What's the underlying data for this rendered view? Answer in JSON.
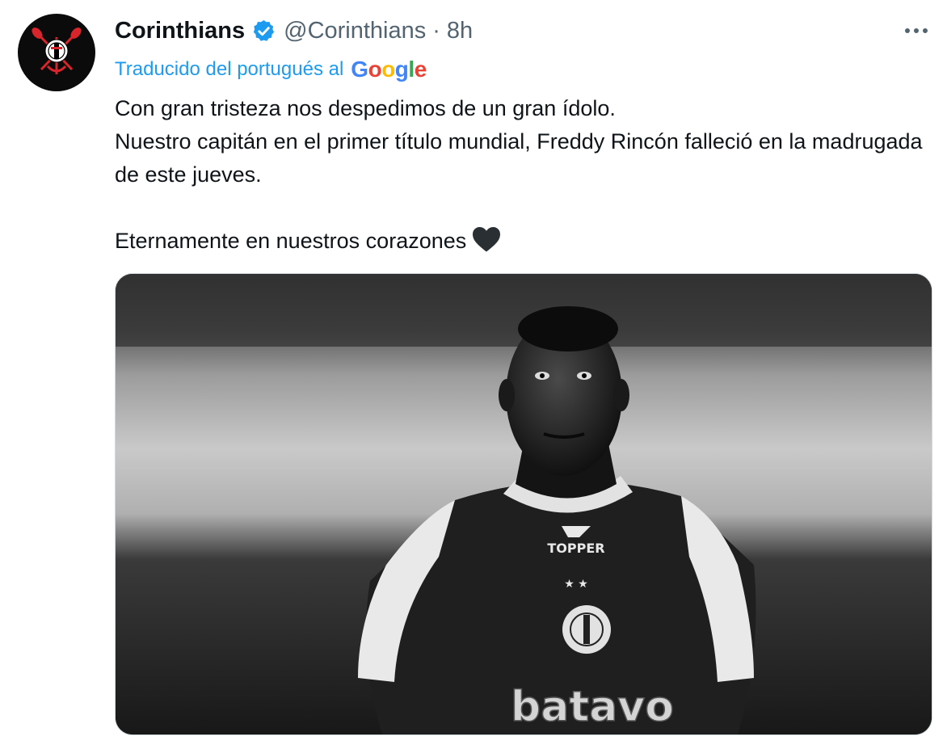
{
  "tweet": {
    "display_name": "Corinthians",
    "handle": "@Corinthians",
    "separator": "·",
    "timestamp": "8h",
    "verified": true,
    "translation": {
      "label": "Traducido del portugués al",
      "provider": [
        "G",
        "o",
        "o",
        "g",
        "l",
        "e"
      ],
      "provider_colors": [
        "#4285f4",
        "#ea4335",
        "#fbbc05",
        "#4285f4",
        "#34a853",
        "#ea4335"
      ]
    },
    "text": {
      "line1": "Con gran tristeza nos despedimos de un gran ídolo.",
      "line2": " Nuestro capitán en el primer título mundial, Freddy Rincón falleció en la madrugada de este jueves.",
      "line3": " Eternamente en nuestros corazones"
    },
    "emoji": "black-heart",
    "media": {
      "kind": "photo",
      "jersey_brand": "TOPPER",
      "sponsor": "batavo"
    }
  },
  "colors": {
    "accent": "#1d9bf0",
    "text_primary": "#0f1419",
    "text_secondary": "#536471",
    "border": "#cfd9de"
  },
  "icons": {
    "avatar": "corinthians-crest-icon",
    "verified": "verified-badge-icon",
    "more": "more-options-icon",
    "emoji": "black-heart-icon"
  }
}
